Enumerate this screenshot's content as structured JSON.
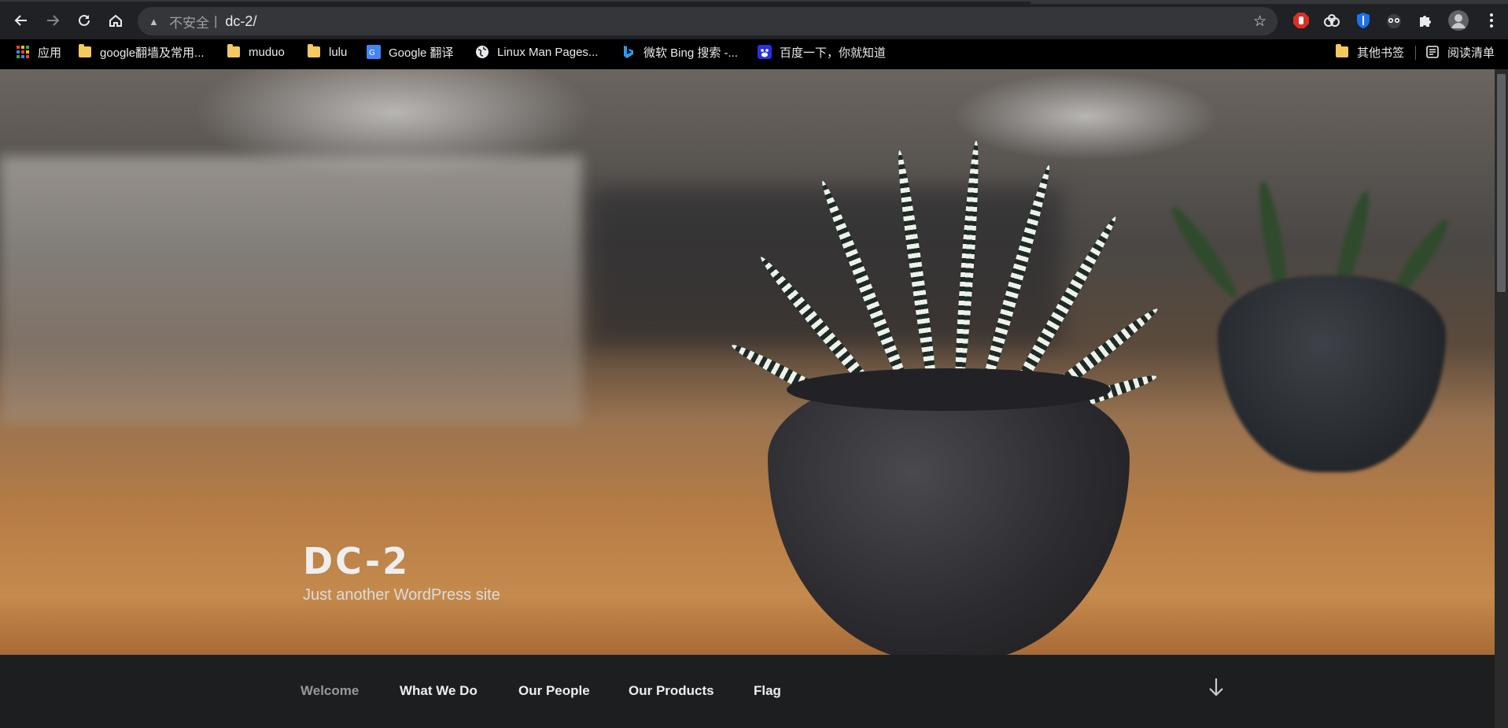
{
  "browser": {
    "omnibox": {
      "security_label": "不安全",
      "separator": "|",
      "url": "dc-2/"
    },
    "bookmarks": [
      {
        "label": "应用",
        "icon": "apps-grid-icon"
      },
      {
        "label": "google翻墙及常用...",
        "icon": "folder-icon"
      },
      {
        "label": "muduo",
        "icon": "folder-icon"
      },
      {
        "label": "lulu",
        "icon": "folder-icon"
      },
      {
        "label": "Google 翻译",
        "icon": "google-translate-icon"
      },
      {
        "label": "Linux Man Pages...",
        "icon": "globe-icon"
      },
      {
        "label": "微软 Bing 搜索 -...",
        "icon": "bing-icon"
      },
      {
        "label": "百度一下，你就知道",
        "icon": "baidu-icon"
      }
    ],
    "other_bookmarks": "其他书签",
    "reading_list": "阅读清单"
  },
  "site": {
    "title": "DC-2",
    "description": "Just another WordPress site"
  },
  "nav": {
    "items": [
      {
        "label": "Welcome",
        "current": true
      },
      {
        "label": "What We Do"
      },
      {
        "label": "Our People"
      },
      {
        "label": "Our Products"
      },
      {
        "label": "Flag"
      }
    ],
    "scroll_icon": "arrow-down-icon"
  },
  "colors": {
    "chrome_bg": "#202124",
    "omnibox_bg": "#35363a",
    "nav_bg": "#1d1e20",
    "current_nav": "#999999"
  }
}
